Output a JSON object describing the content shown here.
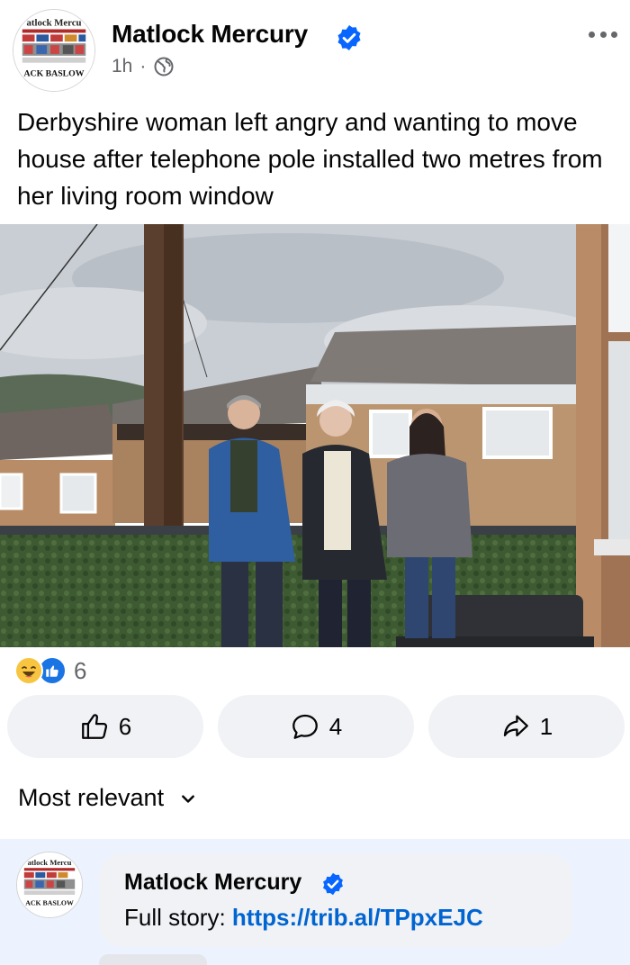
{
  "post": {
    "page_name": "Matlock Mercury",
    "time": "1h",
    "separator": "·",
    "privacy_icon": "globe-icon",
    "verified_icon": "verified-badge-icon",
    "more_icon": "more-options-icon",
    "text": "Derbyshire woman left angry and wanting to move house after telephone pole installed two metres from her living room window",
    "avatar_masthead": "atlock Mercu",
    "avatar_footer": "ACK BASLOW"
  },
  "reactions": {
    "icons": [
      "haha-reaction-icon",
      "like-reaction-icon"
    ],
    "count": "6"
  },
  "actions": {
    "like": {
      "icon": "thumbs-up-icon",
      "count": "6"
    },
    "comment": {
      "icon": "comment-bubble-icon",
      "count": "4"
    },
    "share": {
      "icon": "share-arrow-icon",
      "count": "1"
    }
  },
  "comments": {
    "sort_label": "Most relevant",
    "sort_icon": "chevron-down-icon",
    "items": [
      {
        "author": "Matlock Mercury",
        "text_prefix": "Full story: ",
        "link": "https://trib.al/TPpxEJC",
        "avatar_masthead": "atlock Mercu",
        "avatar_footer": "ACK BASLOW"
      }
    ]
  },
  "colors": {
    "accent_blue": "#0866ff",
    "link_blue": "#0064d1",
    "secondary_text": "#65676b",
    "button_bg": "#f0f2f5",
    "comment_highlight_bg": "#ecf3fe"
  }
}
